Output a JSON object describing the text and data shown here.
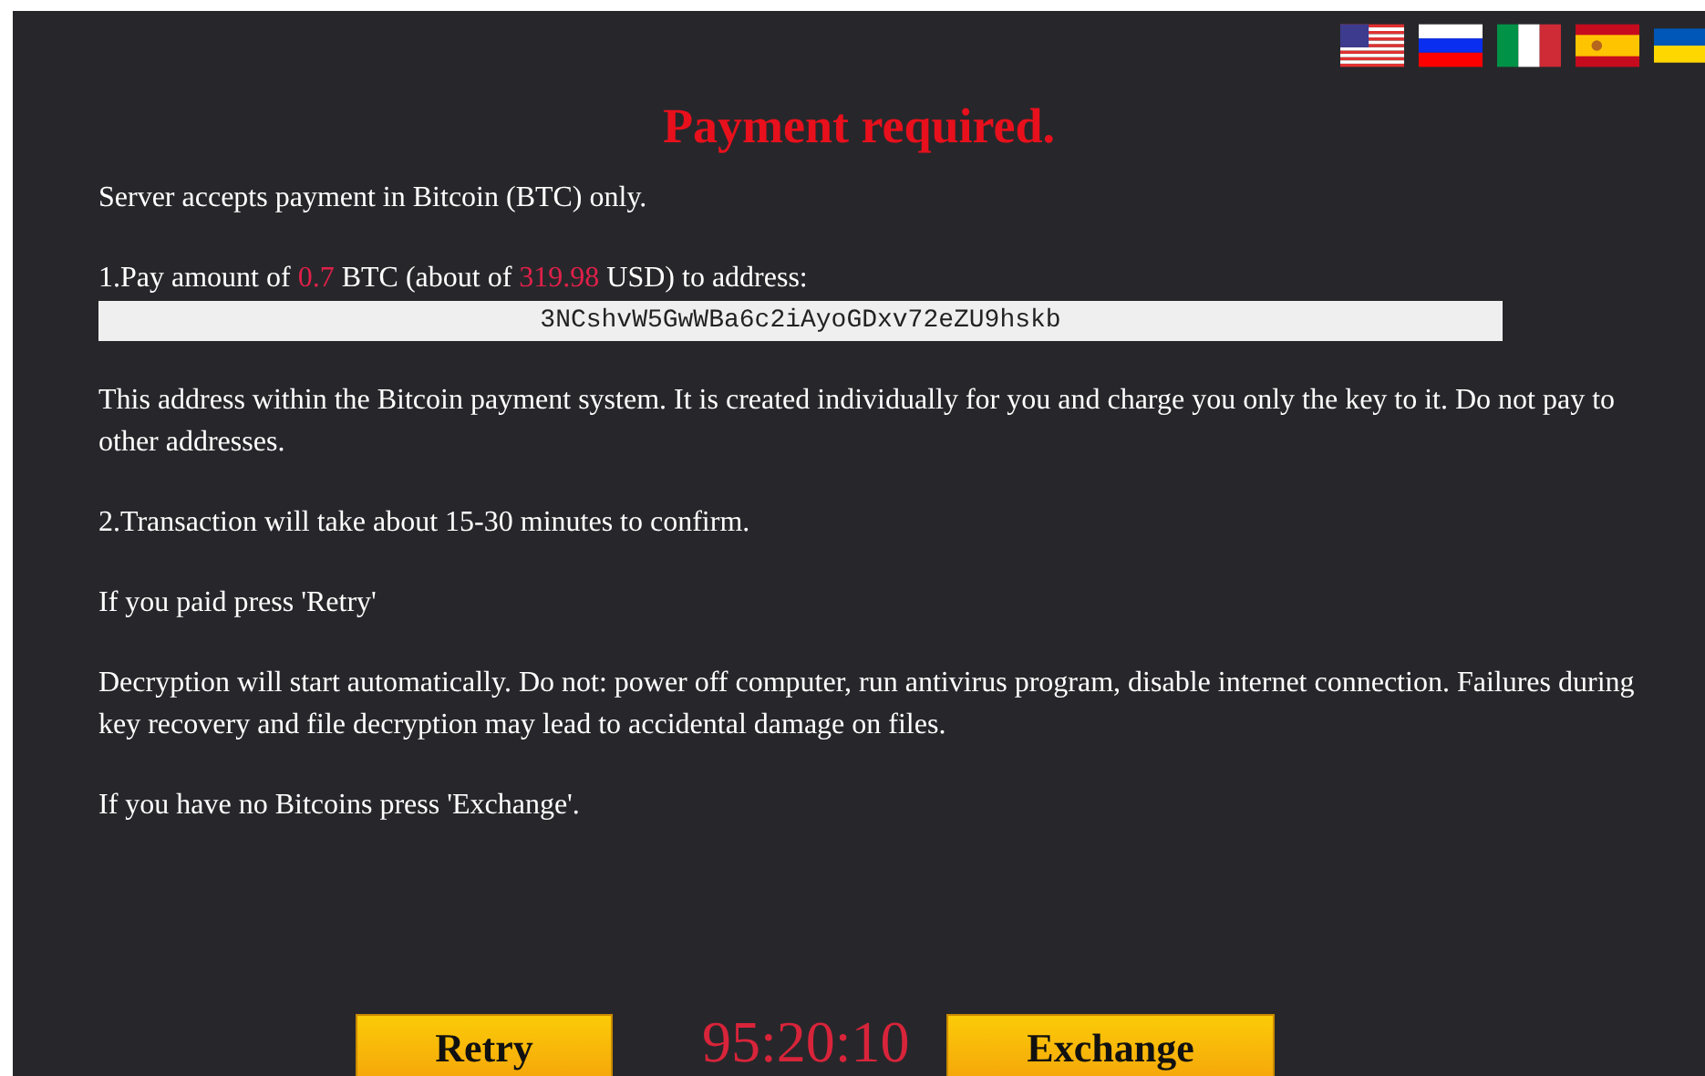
{
  "title": "Payment required.",
  "paragraphs": [
    {
      "kind": "text",
      "parts": [
        {
          "text": "Server accepts payment in Bitcoin (BTC) only.",
          "highlight": false
        }
      ]
    },
    {
      "kind": "amount",
      "parts": [
        {
          "text": "1.Pay amount of ",
          "highlight": false
        },
        {
          "text": "0.7",
          "highlight": true
        },
        {
          "text": " BTC (about of ",
          "highlight": false
        },
        {
          "text": "319.98",
          "highlight": true
        },
        {
          "text": " USD) to address:",
          "highlight": false
        }
      ],
      "address": "3NCshvW5GwWBa6c2iAyoGDxv72eZU9hskb"
    },
    {
      "kind": "text",
      "parts": [
        {
          "text": "This address within the Bitcoin payment system. It is created individually for you and charge you only the key to it. Do not pay to other addresses.",
          "highlight": false
        }
      ]
    },
    {
      "kind": "text",
      "parts": [
        {
          "text": "2.Transaction will take about 15-30 minutes to confirm.",
          "highlight": false
        }
      ]
    },
    {
      "kind": "text",
      "parts": [
        {
          "text": "If you paid press 'Retry'",
          "highlight": false
        }
      ]
    },
    {
      "kind": "text",
      "parts": [
        {
          "text": "Decryption will start automatically. Do not: power off computer, run antivirus program, disable internet connection. Failures during key recovery and file decryption may lead to accidental damage on files.",
          "highlight": false
        }
      ]
    },
    {
      "kind": "text",
      "parts": [
        {
          "text": "If you have no Bitcoins press 'Exchange'.",
          "highlight": false
        }
      ]
    }
  ],
  "retry_button": "Retry",
  "timer": "95:20:10",
  "exchange_button": "Exchange"
}
